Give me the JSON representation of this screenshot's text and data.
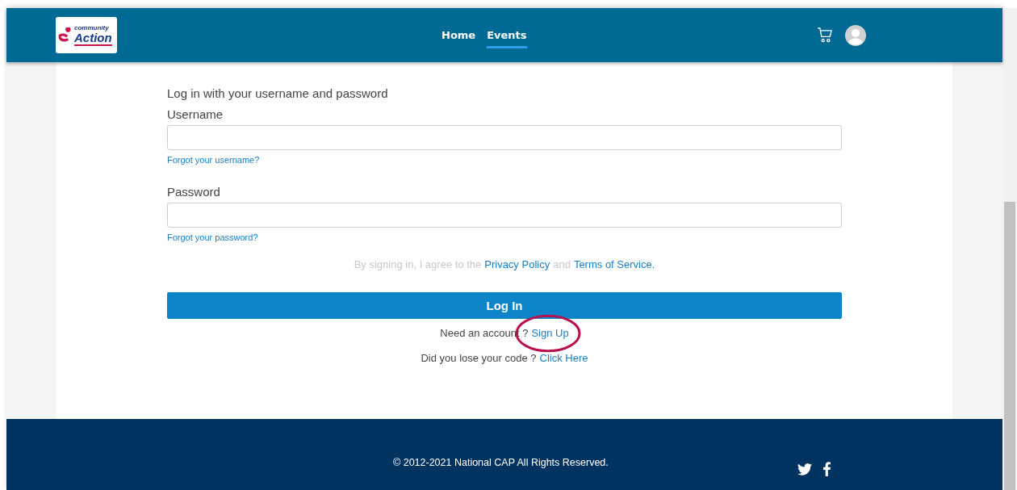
{
  "logo": {
    "line_1": "community",
    "line_2": "Action"
  },
  "nav": [
    {
      "label": "Home",
      "selected": false
    },
    {
      "label": "Events",
      "selected": true
    }
  ],
  "form": {
    "heading": "Log in with your username and password",
    "fields": [
      {
        "label": "Username",
        "link": "Forgot your username?"
      },
      {
        "label": "Password",
        "link": "Forgot your password?"
      }
    ],
    "agreement": {
      "text": "By signing in, I agree to the",
      "link_1": "Privacy Policy",
      "joiner": "and",
      "link_2": "Terms of Service."
    },
    "submit": "Log In",
    "lines": [
      {
        "text": "Need an account ?",
        "link": "Sign Up",
        "annotated": true
      },
      {
        "text": "Did you lose your code ?",
        "link": "Click Here",
        "annotated": false
      }
    ]
  },
  "footer": {
    "copyright": "© 2012-2021 National CAP All Rights Reserved."
  }
}
